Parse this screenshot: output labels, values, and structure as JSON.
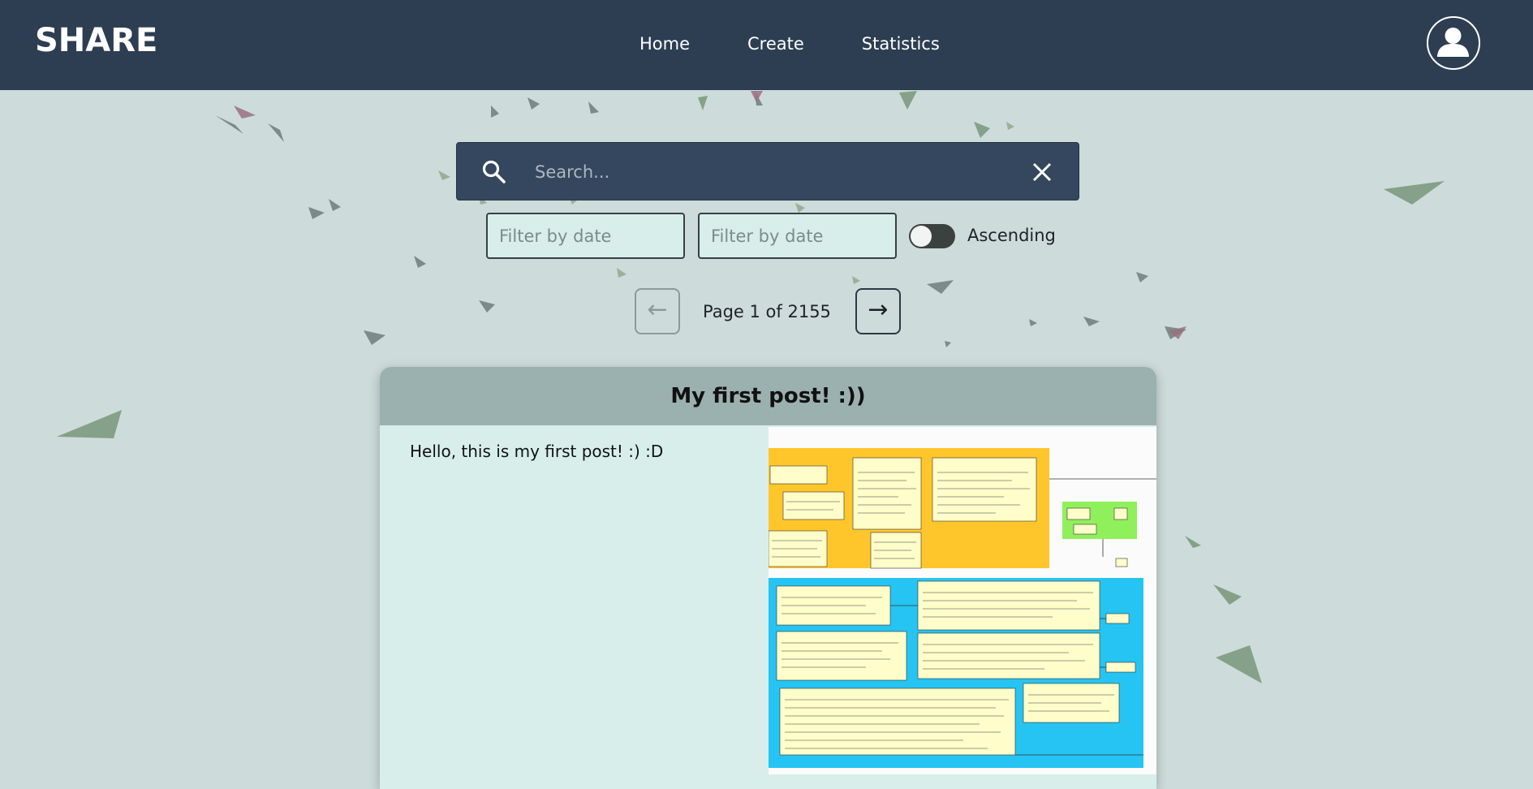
{
  "header": {
    "brand": "SHARE",
    "nav": [
      "Home",
      "Create",
      "Statistics"
    ]
  },
  "search": {
    "placeholder": "Search..."
  },
  "filters": {
    "from_placeholder": "Filter by date",
    "to_placeholder": "Filter by date",
    "sort_label": "Ascending",
    "sort_ascending": false
  },
  "pagination": {
    "prev_label": "←",
    "next_label": "→",
    "page_text": "Page 1 of 2155"
  },
  "post": {
    "title": "My first post! :))",
    "body": "Hello, this is my first post! :) :D"
  },
  "colors": {
    "navbar": "#2d3e52",
    "background": "#cddbda",
    "card": "#d8eeeb",
    "card_header": "#9bb1b0",
    "diagram_orange": "#ffc62b",
    "diagram_green": "#8ff05c",
    "diagram_blue": "#25c4f2"
  }
}
